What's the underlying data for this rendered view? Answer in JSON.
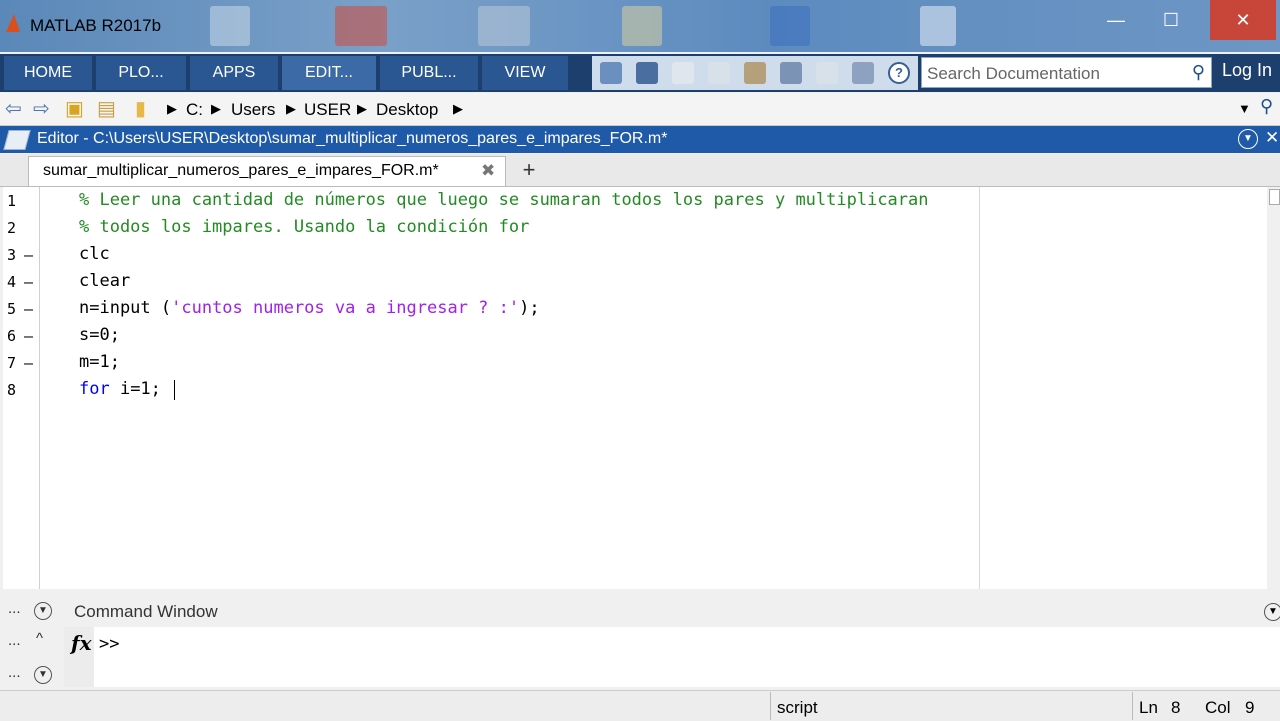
{
  "window": {
    "title": "MATLAB R2017b",
    "minimize_glyph": "—",
    "maximize_glyph": "☐",
    "close_glyph": "✕"
  },
  "ribbon": {
    "tabs": [
      {
        "label": "HOME"
      },
      {
        "label": "PLO..."
      },
      {
        "label": "APPS"
      },
      {
        "label": "EDIT..."
      },
      {
        "label": "PUBL..."
      },
      {
        "label": "VIEW"
      }
    ],
    "search_placeholder": "Search Documentation",
    "login": "Log In"
  },
  "address": {
    "path": [
      "C:",
      "Users",
      "USER",
      "Desktop"
    ]
  },
  "editor": {
    "title": "Editor - C:\\Users\\USER\\Desktop\\sumar_multiplicar_numeros_pares_e_impares_FOR.m*",
    "tab_label": "sumar_multiplicar_numeros_pares_e_impares_FOR.m*",
    "add_tab": "+",
    "lines": [
      {
        "num": "1",
        "dash": "",
        "segments": [
          {
            "t": "% Leer una cantidad de números que luego se sumaran todos los pares y multiplicaran",
            "c": "cmt"
          }
        ]
      },
      {
        "num": "2",
        "dash": "",
        "segments": [
          {
            "t": "% todos los impares. Usando la condición for",
            "c": "cmt"
          }
        ]
      },
      {
        "num": "3",
        "dash": "–",
        "segments": [
          {
            "t": "clc",
            "c": ""
          }
        ]
      },
      {
        "num": "4",
        "dash": "–",
        "segments": [
          {
            "t": "clear",
            "c": ""
          }
        ]
      },
      {
        "num": "5",
        "dash": "–",
        "segments": [
          {
            "t": "n=input (",
            "c": ""
          },
          {
            "t": "'cuntos numeros va a ingresar ? :'",
            "c": "str"
          },
          {
            "t": ");",
            "c": ""
          }
        ]
      },
      {
        "num": "6",
        "dash": "–",
        "segments": [
          {
            "t": "s=0;",
            "c": ""
          }
        ]
      },
      {
        "num": "7",
        "dash": "–",
        "segments": [
          {
            "t": "m=1;",
            "c": ""
          }
        ]
      },
      {
        "num": "8",
        "dash": "",
        "segments": [
          {
            "t": "for",
            "c": "kw"
          },
          {
            "t": " i=1;",
            "c": ""
          }
        ]
      }
    ]
  },
  "command_window": {
    "title": "Command Window",
    "fx": "fx",
    "prompt": ">>",
    "side_dots": "..."
  },
  "status": {
    "mode": "script",
    "ln_label": "Ln",
    "ln_value": "8",
    "col_label": "Col",
    "col_value": "9"
  },
  "colors": {
    "comment": "#228b22",
    "string": "#a020f0",
    "keyword": "#0000ff",
    "ribbon": "#1d3f6e",
    "editor_header": "#1f5aa8"
  }
}
